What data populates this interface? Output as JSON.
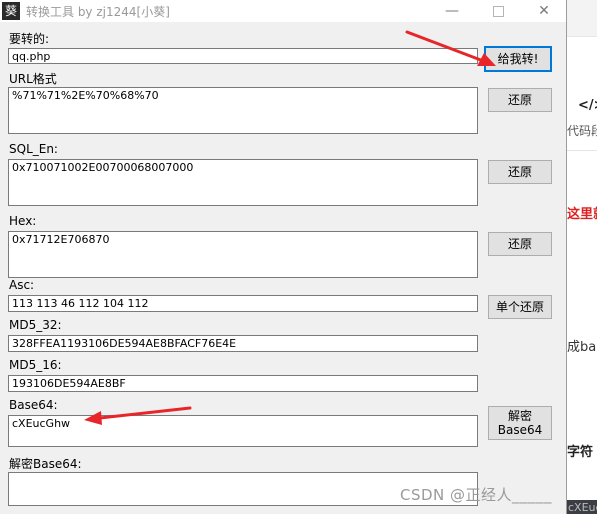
{
  "window": {
    "icon_glyph": "葵",
    "title": "转换工具 by zj1244[小葵]",
    "controls": {
      "minimize": "—",
      "close": "✕"
    }
  },
  "fields": {
    "input": {
      "label": "要转的:",
      "value": "qq.php"
    },
    "url": {
      "label": "URL格式",
      "value": "%71%71%2E%70%68%70"
    },
    "sql": {
      "label": "SQL_En:",
      "value": "0x710071002E00700068007000"
    },
    "hex": {
      "label": "Hex:",
      "value": "0x71712E706870"
    },
    "asc": {
      "label": "Asc:",
      "value": "113 113 46 112 104 112"
    },
    "md5_32": {
      "label": "MD5_32:",
      "value": "328FFEA1193106DE594AE8BFACF76E4E"
    },
    "md5_16": {
      "label": "MD5_16:",
      "value": "193106DE594AE8BF"
    },
    "base64": {
      "label": "Base64:",
      "value": "cXEucGhw"
    },
    "decode_base64": {
      "label": "解密Base64:",
      "value": ""
    }
  },
  "buttons": {
    "convert": "给我转!",
    "restore_url": "还原",
    "restore_sql": "还原",
    "restore_hex": "还原",
    "restore_asc": "单个还原",
    "decode_line1": "解密",
    "decode_line2": "Base64"
  },
  "background_page": {
    "code_icon": "</>",
    "code_label": "代码段",
    "red_text": "这里就",
    "text1": "成ba",
    "text2": "字符",
    "bottom_text": "cXEucGhw",
    "watermark": "CSDN @正经人_____"
  },
  "colors": {
    "arrow": "#e8262a",
    "primary_border": "#0078d7"
  }
}
